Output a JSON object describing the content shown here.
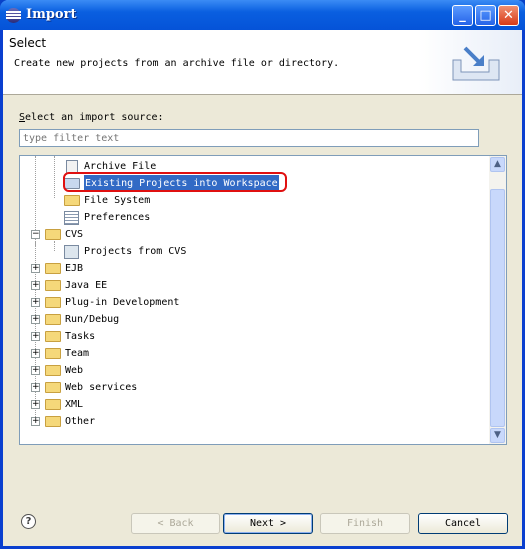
{
  "window": {
    "title": "Import"
  },
  "header": {
    "title": "Select",
    "description": "Create new projects from an archive file or directory."
  },
  "source": {
    "label_prefix": "S",
    "label_rest": "elect an import source:",
    "filter_placeholder": "type filter text"
  },
  "tree": {
    "children": [
      {
        "label": "Archive File",
        "icon": "archive-file-icon"
      },
      {
        "label": "Existing Projects into Workspace",
        "icon": "project-folder-icon",
        "selected": true
      },
      {
        "label": "File System",
        "icon": "folder-icon"
      },
      {
        "label": "Preferences",
        "icon": "preferences-icon"
      }
    ],
    "cvs": {
      "label": "CVS",
      "child": "Projects from CVS"
    },
    "groups": [
      "EJB",
      "Java EE",
      "Plug-in Development",
      "Run/Debug",
      "Tasks",
      "Team",
      "Web",
      "Web services",
      "XML",
      "Other"
    ]
  },
  "buttons": {
    "back": "< Back",
    "next": "Next >",
    "finish": "Finish",
    "cancel": "Cancel",
    "help": "?"
  },
  "colors": {
    "titlebar": "#0a5fe0",
    "selection": "#316ac5",
    "highlight": "#e01010"
  }
}
